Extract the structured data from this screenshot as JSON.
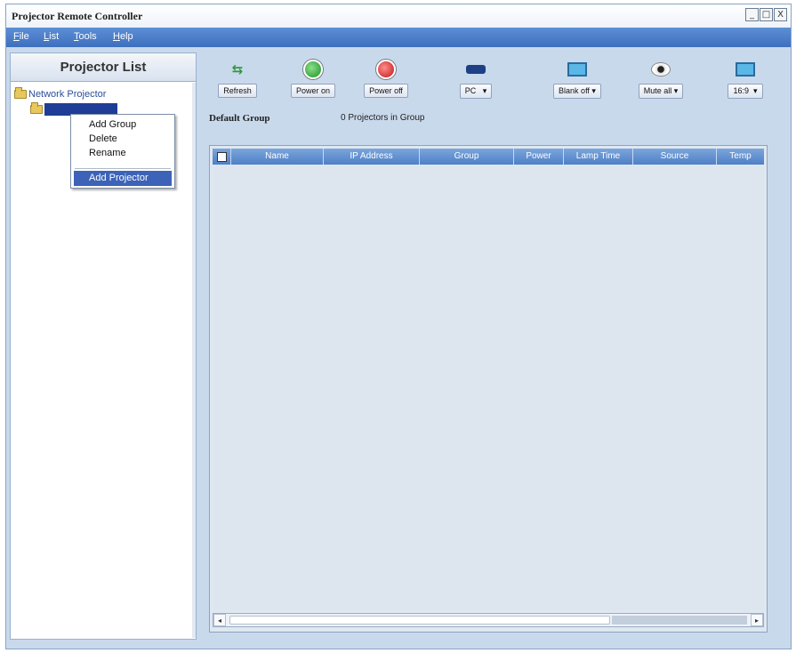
{
  "window": {
    "title": "Projector Remote Controller",
    "controls": [
      "_",
      "□",
      "X"
    ]
  },
  "menu": [
    {
      "label": "File",
      "mnemonic": "F"
    },
    {
      "label": "List",
      "mnemonic": "L"
    },
    {
      "label": "Tools",
      "mnemonic": "T"
    },
    {
      "label": "Help",
      "mnemonic": "H"
    }
  ],
  "left_panel": {
    "header": "Projector List",
    "tree": {
      "root": "Network Projector"
    },
    "context_menu": [
      "Add Group",
      "Delete",
      "Rename",
      "Add Projector"
    ]
  },
  "toolbar": [
    {
      "label": "Refresh",
      "icon": "refresh-icon"
    },
    {
      "label": "Power on",
      "icon": "power-on-icon"
    },
    {
      "label": "Power off",
      "icon": "power-off-icon"
    },
    {
      "label": "PC",
      "icon": "pc-source-icon",
      "dropdown": true
    },
    {
      "label": "Blank off",
      "icon": "blank-icon",
      "dropdown": true
    },
    {
      "label": "Mute all",
      "icon": "mute-icon",
      "dropdown": true
    },
    {
      "label": "16:9",
      "icon": "aspect-ratio-icon",
      "dropdown": true
    }
  ],
  "group": {
    "name": "Default Group",
    "count_text": "0 Projectors in Group"
  },
  "table": {
    "columns": [
      "Name",
      "IP Address",
      "Group",
      "Power",
      "Lamp Time",
      "Source",
      "Temp"
    ],
    "rows": []
  }
}
